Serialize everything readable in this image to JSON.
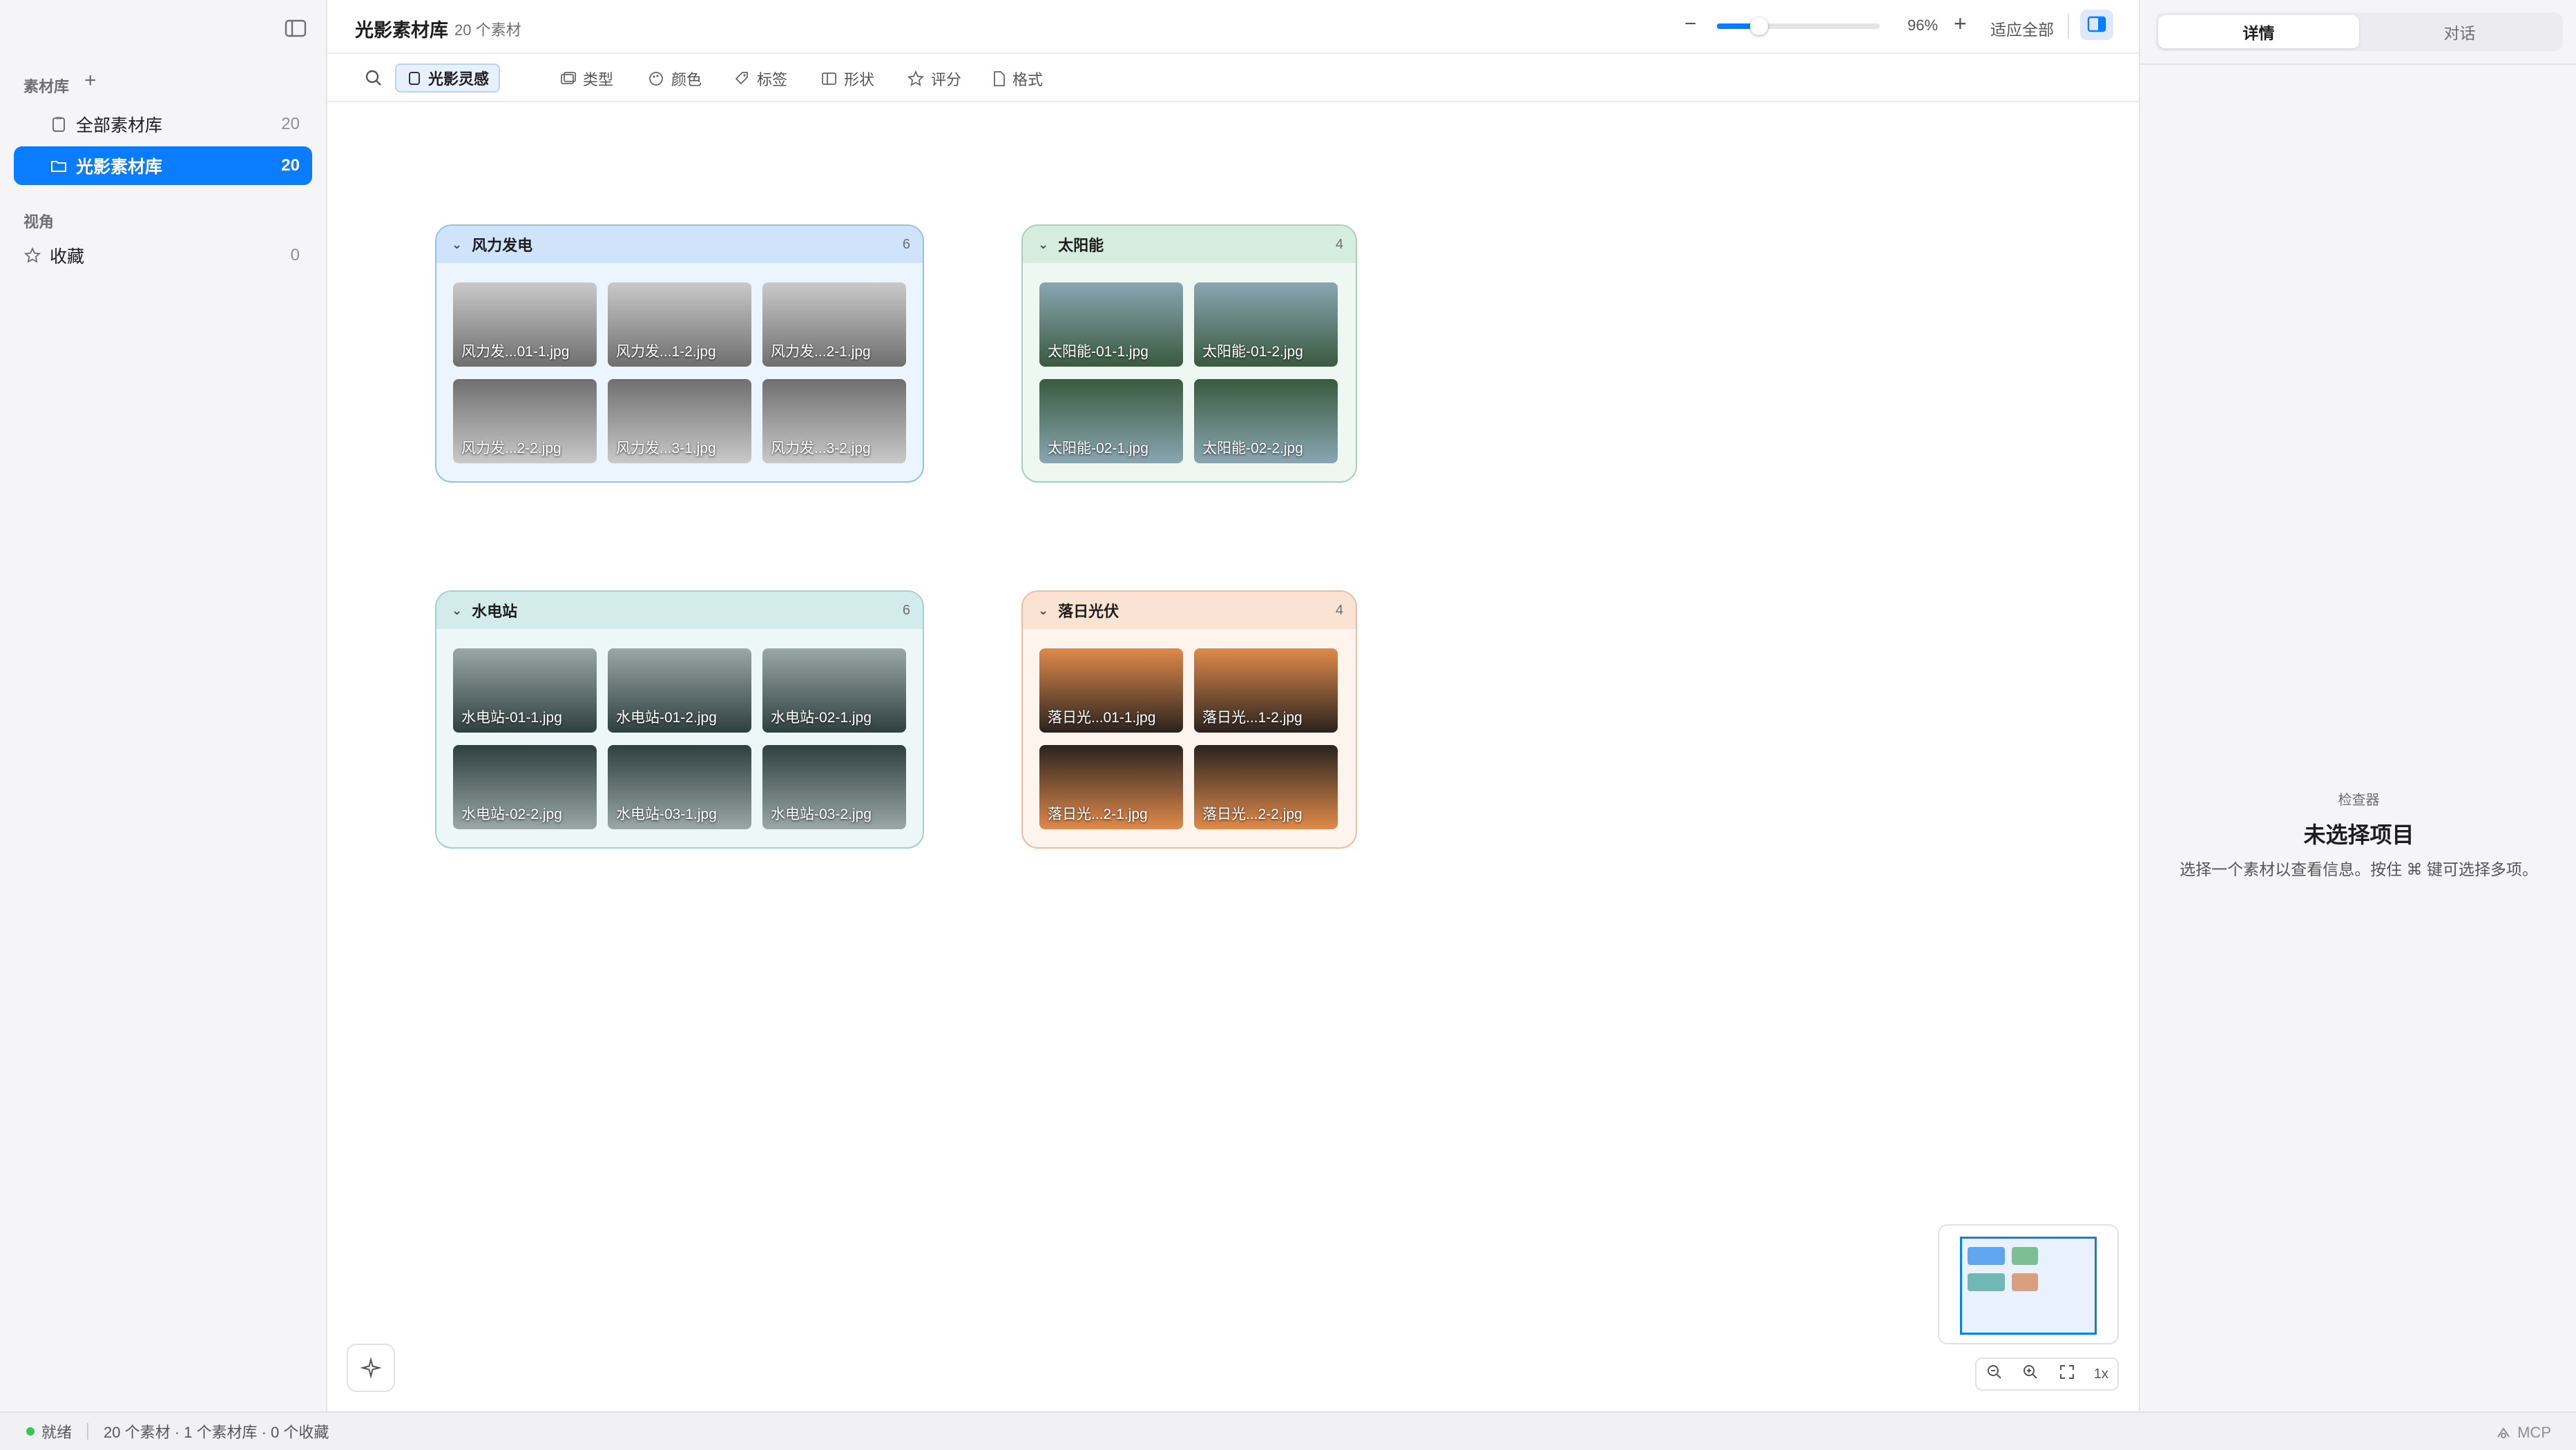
{
  "sidebar": {
    "library_heading": "素材库",
    "items": [
      {
        "label": "全部素材库",
        "count": "20"
      },
      {
        "label": "光影素材库",
        "count": "20"
      }
    ],
    "views_heading": "视角",
    "favorites": {
      "label": "收藏",
      "count": "0"
    }
  },
  "header": {
    "title": "光影素材库",
    "subtitle": "20 个素材",
    "zoom_percent": "96%",
    "zoom_level": 0.26,
    "fit_all": "适应全部"
  },
  "filters": {
    "active_chip": "光影灵感",
    "items": [
      "类型",
      "颜色",
      "标签",
      "形状",
      "评分",
      "格式"
    ]
  },
  "groups": [
    {
      "name": "风力发电",
      "count": "6",
      "color": "#cfe3fb",
      "border": "#94c1f3",
      "files": [
        "风力发...01-1.jpg",
        "风力发...1-2.jpg",
        "风力发...2-1.jpg",
        "风力发...2-2.jpg",
        "风力发...3-1.jpg",
        "风力发...3-2.jpg"
      ]
    },
    {
      "name": "太阳能",
      "count": "4",
      "color": "#d6ecdf",
      "border": "#a6d3b7",
      "files": [
        "太阳能-01-1.jpg",
        "太阳能-01-2.jpg",
        "太阳能-02-1.jpg",
        "太阳能-02-2.jpg"
      ]
    },
    {
      "name": "水电站",
      "count": "6",
      "color": "#d3eceb",
      "border": "#9fd3cf",
      "files": [
        "水电站-01-1.jpg",
        "水电站-01-2.jpg",
        "水电站-02-1.jpg",
        "水电站-02-2.jpg",
        "水电站-03-1.jpg",
        "水电站-03-2.jpg"
      ]
    },
    {
      "name": "落日光伏",
      "count": "4",
      "color": "#fbe3d4",
      "border": "#f0bc9c",
      "files": [
        "落日光...01-1.jpg",
        "落日光...1-2.jpg",
        "落日光...2-1.jpg",
        "落日光...2-2.jpg"
      ]
    }
  ],
  "minimap": {
    "tools": [
      "zoom-out-icon",
      "zoom-in-icon",
      "fit-icon",
      "1x"
    ]
  },
  "inspector": {
    "tabs": [
      "详情",
      "对话"
    ],
    "kicker": "检查器",
    "title": "未选择项目",
    "description": "选择一个素材以查看信息。按住 ⌘ 键可选择多项。"
  },
  "status": {
    "state": "就绪",
    "summary": "20 个素材 · 1 个素材库 · 0 个收藏",
    "mcp": "MCP"
  }
}
